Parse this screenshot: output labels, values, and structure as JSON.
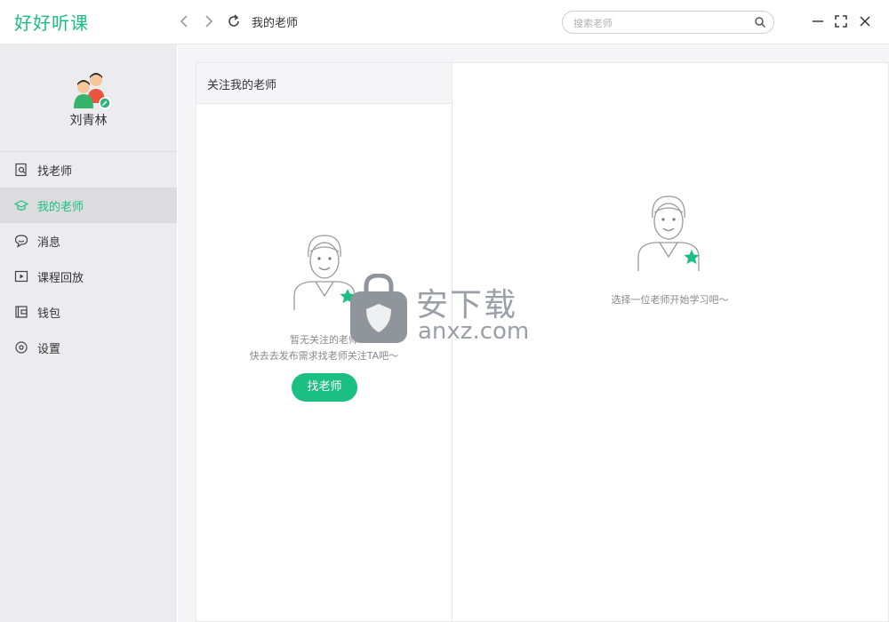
{
  "app": {
    "logo_text": "好好听课"
  },
  "header": {
    "page_title": "我的老师",
    "search_placeholder": "搜索老师"
  },
  "user": {
    "name": "刘青林"
  },
  "sidebar": {
    "items": [
      {
        "label": "找老师",
        "icon": "find-teacher-icon",
        "active": false
      },
      {
        "label": "我的老师",
        "icon": "graduation-cap-icon",
        "active": true
      },
      {
        "label": "消息",
        "icon": "message-icon",
        "active": false
      },
      {
        "label": "课程回放",
        "icon": "play-icon",
        "active": false
      },
      {
        "label": "钱包",
        "icon": "wallet-icon",
        "active": false
      },
      {
        "label": "设置",
        "icon": "settings-icon",
        "active": false
      }
    ]
  },
  "left_panel": {
    "title": "关注我的老师",
    "empty_line1": "暂无关注的老师",
    "empty_line2": "快去去发布需求找老师关注TA吧～",
    "button_label": "找老师"
  },
  "right_panel": {
    "empty_message": "选择一位老师开始学习吧～"
  },
  "watermark": {
    "text": "安下载",
    "sub": "anxz.com"
  },
  "colors": {
    "accent": "#1bbf83",
    "sidebar_bg": "#ececef",
    "active_bg": "#dcdcdf"
  }
}
